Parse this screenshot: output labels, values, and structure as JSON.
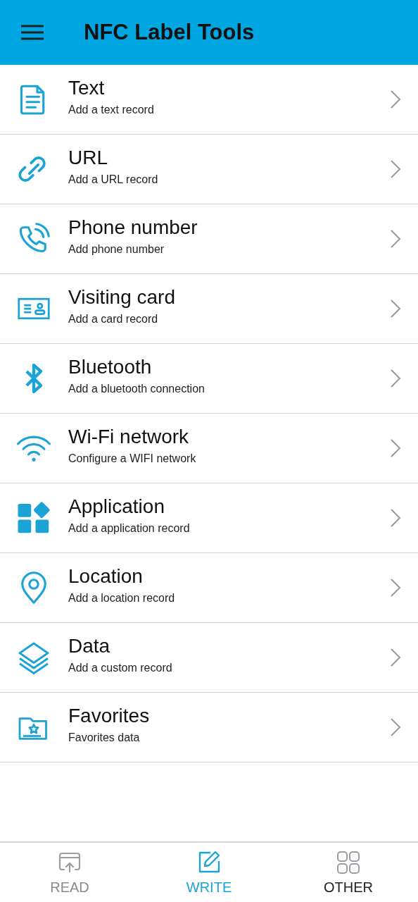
{
  "app_bar": {
    "title": "NFC Label Tools"
  },
  "items": [
    {
      "kind": "text",
      "title": "Text",
      "subtitle": "Add a text record"
    },
    {
      "kind": "url",
      "title": "URL",
      "subtitle": "Add a URL record"
    },
    {
      "kind": "phone",
      "title": "Phone number",
      "subtitle": "Add phone number"
    },
    {
      "kind": "card",
      "title": "Visiting card",
      "subtitle": "Add a card record"
    },
    {
      "kind": "bluetooth",
      "title": "Bluetooth",
      "subtitle": "Add a bluetooth connection"
    },
    {
      "kind": "wifi",
      "title": "Wi-Fi network",
      "subtitle": "Configure a WIFI network"
    },
    {
      "kind": "app",
      "title": "Application",
      "subtitle": "Add a application record"
    },
    {
      "kind": "location",
      "title": "Location",
      "subtitle": "Add a location record"
    },
    {
      "kind": "data",
      "title": "Data",
      "subtitle": "Add a custom record"
    },
    {
      "kind": "favorites",
      "title": "Favorites",
      "subtitle": "Favorites data"
    }
  ],
  "bottom_nav": [
    {
      "kind": "read",
      "label": "READ",
      "selected": false,
      "color": "#888c90"
    },
    {
      "kind": "write",
      "label": "WRITE",
      "selected": true,
      "color": "#1ba3d6"
    },
    {
      "kind": "other",
      "label": "OTHER",
      "selected": false,
      "color": "#222222"
    }
  ]
}
